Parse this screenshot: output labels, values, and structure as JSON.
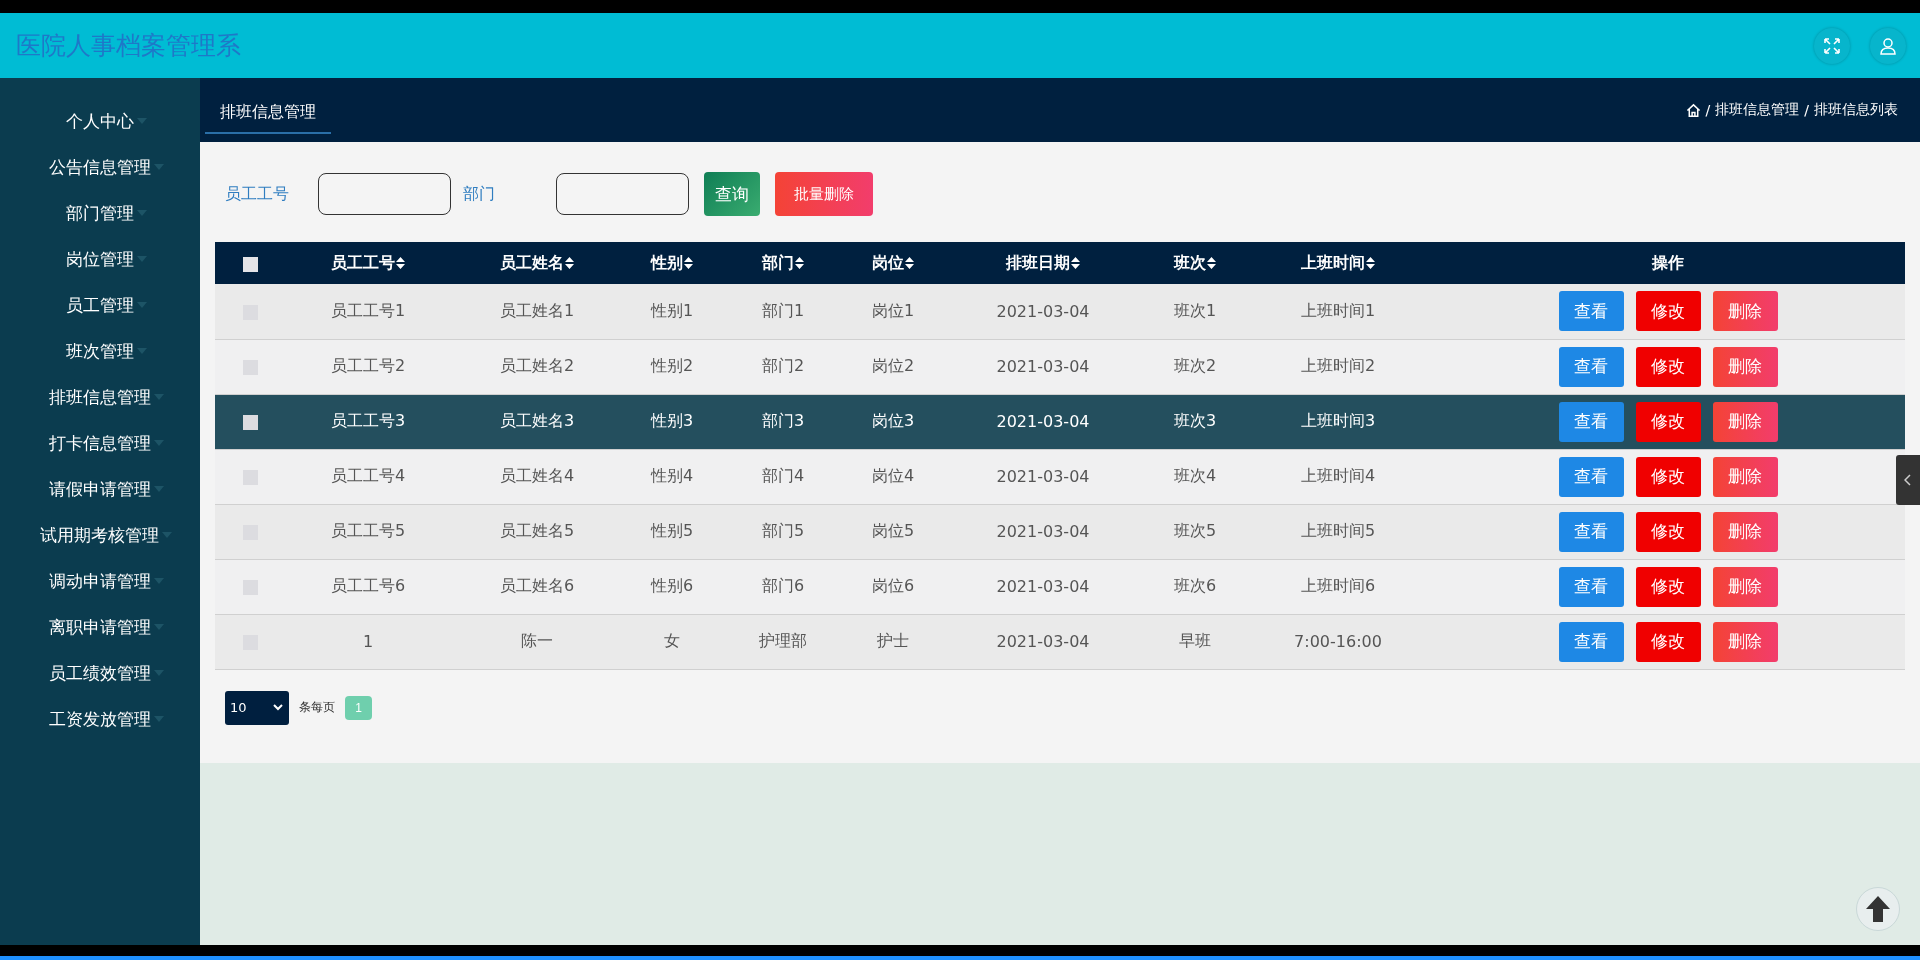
{
  "header": {
    "title": "医院人事档案管理系"
  },
  "sidebar": {
    "items": [
      {
        "label": "个人中心"
      },
      {
        "label": "公告信息管理"
      },
      {
        "label": "部门管理"
      },
      {
        "label": "岗位管理"
      },
      {
        "label": "员工管理"
      },
      {
        "label": "班次管理"
      },
      {
        "label": "排班信息管理"
      },
      {
        "label": "打卡信息管理"
      },
      {
        "label": "请假申请管理"
      },
      {
        "label": "试用期考核管理"
      },
      {
        "label": "调动申请管理"
      },
      {
        "label": "离职申请管理"
      },
      {
        "label": "员工绩效管理"
      },
      {
        "label": "工资发放管理"
      }
    ]
  },
  "tabs": [
    {
      "label": "排班信息管理",
      "selected": true
    }
  ],
  "breadcrumb": {
    "separator": "/",
    "items": [
      "排班信息管理",
      "排班信息列表"
    ]
  },
  "search": {
    "fields": [
      {
        "label": "员工工号"
      },
      {
        "label": "部门"
      }
    ],
    "query_button": "查询",
    "batch_delete_button": "批量删除"
  },
  "table": {
    "select_all_checked": false,
    "columns": [
      {
        "label": "员工工号",
        "sortable": true
      },
      {
        "label": "员工姓名",
        "sortable": true
      },
      {
        "label": "性别",
        "sortable": true
      },
      {
        "label": "部门",
        "sortable": true
      },
      {
        "label": "岗位",
        "sortable": true
      },
      {
        "label": "排班日期",
        "sortable": true
      },
      {
        "label": "班次",
        "sortable": true
      },
      {
        "label": "上班时间",
        "sortable": true
      },
      {
        "label": "操作",
        "sortable": false
      }
    ],
    "rows": [
      {
        "checked": false,
        "highlighted": false,
        "cells": [
          "员工工号1",
          "员工姓名1",
          "性别1",
          "部门1",
          "岗位1",
          "2021-03-04",
          "班次1",
          "上班时间1"
        ],
        "actions": [
          {
            "kind": "view",
            "label": "查看"
          },
          {
            "kind": "edit",
            "label": "修改"
          },
          {
            "kind": "delete",
            "label": "删除"
          }
        ]
      },
      {
        "checked": false,
        "highlighted": false,
        "cells": [
          "员工工号2",
          "员工姓名2",
          "性别2",
          "部门2",
          "岗位2",
          "2021-03-04",
          "班次2",
          "上班时间2"
        ],
        "actions": [
          {
            "kind": "view",
            "label": "查看"
          },
          {
            "kind": "edit",
            "label": "修改"
          },
          {
            "kind": "delete",
            "label": "删除"
          }
        ]
      },
      {
        "checked": false,
        "highlighted": true,
        "cells": [
          "员工工号3",
          "员工姓名3",
          "性别3",
          "部门3",
          "岗位3",
          "2021-03-04",
          "班次3",
          "上班时间3"
        ],
        "actions": [
          {
            "kind": "view",
            "label": "查看"
          },
          {
            "kind": "edit",
            "label": "修改"
          },
          {
            "kind": "delete",
            "label": "删除"
          }
        ]
      },
      {
        "checked": false,
        "highlighted": false,
        "cells": [
          "员工工号4",
          "员工姓名4",
          "性别4",
          "部门4",
          "岗位4",
          "2021-03-04",
          "班次4",
          "上班时间4"
        ],
        "actions": [
          {
            "kind": "view",
            "label": "查看"
          },
          {
            "kind": "edit",
            "label": "修改"
          },
          {
            "kind": "delete",
            "label": "删除"
          }
        ]
      },
      {
        "checked": false,
        "highlighted": false,
        "cells": [
          "员工工号5",
          "员工姓名5",
          "性别5",
          "部门5",
          "岗位5",
          "2021-03-04",
          "班次5",
          "上班时间5"
        ],
        "actions": [
          {
            "kind": "view",
            "label": "查看"
          },
          {
            "kind": "edit",
            "label": "修改"
          },
          {
            "kind": "delete",
            "label": "删除"
          }
        ]
      },
      {
        "checked": false,
        "highlighted": false,
        "cells": [
          "员工工号6",
          "员工姓名6",
          "性别6",
          "部门6",
          "岗位6",
          "2021-03-04",
          "班次6",
          "上班时间6"
        ],
        "actions": [
          {
            "kind": "view",
            "label": "查看"
          },
          {
            "kind": "edit",
            "label": "修改"
          },
          {
            "kind": "delete",
            "label": "删除"
          }
        ]
      },
      {
        "checked": false,
        "highlighted": false,
        "cells": [
          "1",
          "陈一",
          "女",
          "护理部",
          "护士",
          "2021-03-04",
          "早班",
          "7:00-16:00"
        ],
        "actions": [
          {
            "kind": "view",
            "label": "查看"
          },
          {
            "kind": "edit",
            "label": "修改"
          },
          {
            "kind": "delete",
            "label": "删除"
          }
        ]
      }
    ]
  },
  "pagination": {
    "page_size": "10",
    "per_page_label": "条每页",
    "pages": [
      {
        "label": "1",
        "selected": true
      }
    ]
  }
}
